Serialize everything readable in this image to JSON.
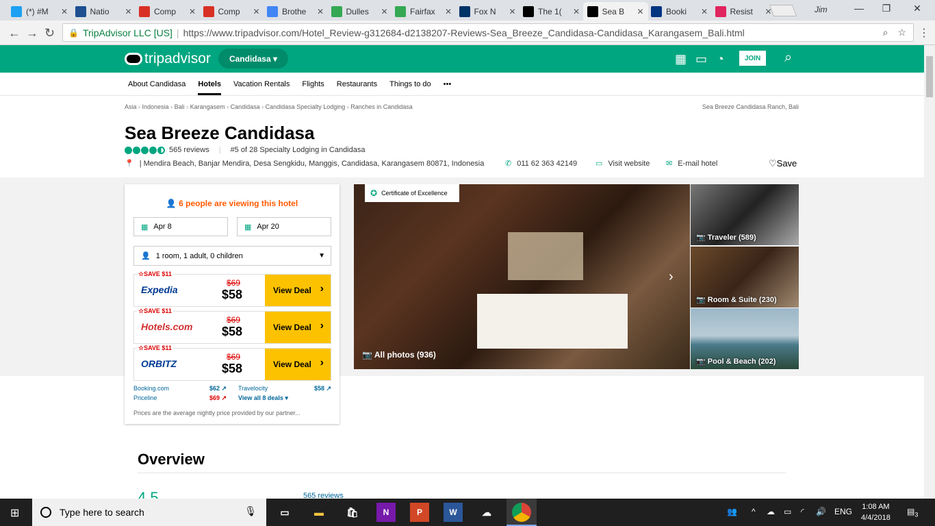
{
  "browser": {
    "tabs": [
      {
        "title": "(*) #M",
        "icon": "twitter-icon",
        "color": "#1da1f2"
      },
      {
        "title": "Natio",
        "icon": "weather-channel-icon",
        "color": "#1d4f91"
      },
      {
        "title": "Comp",
        "icon": "gmail-icon",
        "color": "#d93025"
      },
      {
        "title": "Comp",
        "icon": "gmail-icon",
        "color": "#d93025"
      },
      {
        "title": "Brothe",
        "icon": "docs-icon",
        "color": "#4285f4"
      },
      {
        "title": "Dulles",
        "icon": "maps-icon",
        "color": "#34a853"
      },
      {
        "title": "Fairfax",
        "icon": "maps-icon",
        "color": "#34a853"
      },
      {
        "title": "Fox N",
        "icon": "fox-news-icon",
        "color": "#003366"
      },
      {
        "title": "The 1(",
        "icon": "tripadvisor-icon",
        "color": "#000000"
      },
      {
        "title": "Sea B",
        "icon": "tripadvisor-icon",
        "color": "#000000",
        "active": true
      },
      {
        "title": "Booki",
        "icon": "booking-icon",
        "color": "#003580"
      },
      {
        "title": "Resist",
        "icon": "resist-icon",
        "color": "#e0245e"
      }
    ],
    "user": "Jim",
    "secure_label": "TripAdvisor LLC [US]",
    "url": "https://www.tripadvisor.com/Hotel_Review-g312684-d2138207-Reviews-Sea_Breeze_Candidasa-Candidasa_Karangasem_Bali.html"
  },
  "header": {
    "logo": "tripadvisor",
    "city_button": "Candidasa",
    "join": "JOIN",
    "nav": [
      "About Candidasa",
      "Hotels",
      "Vacation Rentals",
      "Flights",
      "Restaurants",
      "Things to do",
      "•••"
    ],
    "active_nav": "Hotels"
  },
  "breadcrumbs": [
    "Asia",
    "Indonesia",
    "Bali",
    "Karangasem",
    "Candidasa",
    "Candidasa Specialty Lodging",
    "Ranches in Candidasa"
  ],
  "breadcrumb_right": "Sea Breeze Candidasa Ranch, Bali",
  "hotel": {
    "name": "Sea Breeze Candidasa",
    "reviews": "565 reviews",
    "rank": "#5 of 28 Specialty Lodging in Candidasa",
    "address": "| Mendira Beach, Banjar Mendira, Desa Sengkidu, Manggis, Candidasa, Karangasem 80871, Indonesia",
    "phone": "011 62 363 42149",
    "website": "Visit website",
    "email": "E-mail hotel",
    "save": "Save"
  },
  "booking": {
    "viewing": "6 people are viewing this hotel",
    "checkin": "Apr 8",
    "checkout": "Apr 20",
    "guests": "1 room, 1 adult, 0 children",
    "deals": [
      {
        "save": "SAVE $11",
        "provider": "Expedia",
        "old": "$69",
        "price": "$58",
        "cta": "View Deal",
        "color": "#003b95"
      },
      {
        "save": "SAVE $11",
        "provider": "Hotels.com",
        "old": "$69",
        "price": "$58",
        "cta": "View Deal",
        "color": "#d32f2f"
      },
      {
        "save": "SAVE $11",
        "provider": "ORBITZ",
        "old": "$69",
        "price": "$58",
        "cta": "View Deal",
        "color": "#003b95"
      }
    ],
    "others": [
      {
        "name": "Booking.com",
        "price": "$62 ↗"
      },
      {
        "name": "Travelocity",
        "price": "$58 ↗"
      },
      {
        "name": "Priceline",
        "price": "$69 ↗"
      },
      {
        "name": "View all 8 deals ▾",
        "price": ""
      }
    ],
    "note": "Prices are the average nightly price provided by our partner..."
  },
  "photos": {
    "certificate": "Certificate of Excellence",
    "all": "All photos (936)",
    "thumbs": [
      {
        "label": "Traveler (589)"
      },
      {
        "label": "Room & Suite (230)"
      },
      {
        "label": "Pool & Beach (202)"
      }
    ]
  },
  "overview": {
    "title": "Overview",
    "score": "4.5",
    "reviews": "565 reviews"
  },
  "taskbar": {
    "search": "Type here to search",
    "lang": "ENG",
    "time": "1:08 AM",
    "date": "4/4/2018",
    "notifications": "3"
  }
}
